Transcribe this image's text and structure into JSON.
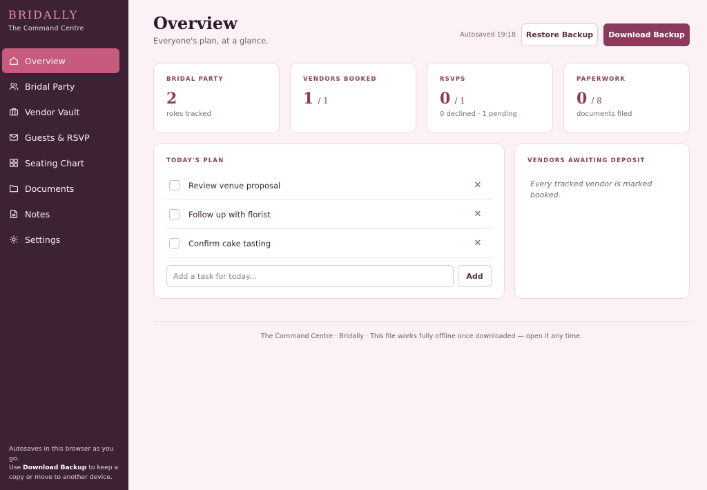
{
  "brand": {
    "name": "BRIDALLY",
    "subtitle": "The Command Centre"
  },
  "nav": [
    {
      "label": "Overview",
      "icon": "home-icon",
      "active": true
    },
    {
      "label": "Bridal Party",
      "icon": "users-icon",
      "active": false
    },
    {
      "label": "Vendor Vault",
      "icon": "briefcase-icon",
      "active": false
    },
    {
      "label": "Guests & RSVP",
      "icon": "envelope-icon",
      "active": false
    },
    {
      "label": "Seating Chart",
      "icon": "grid-icon",
      "active": false
    },
    {
      "label": "Documents",
      "icon": "folder-icon",
      "active": false
    },
    {
      "label": "Notes",
      "icon": "document-icon",
      "active": false
    },
    {
      "label": "Settings",
      "icon": "gear-icon",
      "active": false
    }
  ],
  "sidebar_footer": {
    "line1": "Autosaves in this browser as you go.",
    "line2_prefix": "Use ",
    "line2_bold": "Download Backup",
    "line2_suffix": " to keep a copy or move to another device."
  },
  "header": {
    "title": "Overview",
    "subtitle": "Everyone's plan, at a glance.",
    "autosave": "Autosaved 19:18",
    "restore_label": "Restore Backup",
    "download_label": "Download Backup"
  },
  "stats": [
    {
      "label": "BRIDAL PARTY",
      "value": "2",
      "of": "",
      "caption": "roles tracked"
    },
    {
      "label": "VENDORS BOOKED",
      "value": "1",
      "of": "/ 1",
      "caption": ""
    },
    {
      "label": "RSVPS",
      "value": "0",
      "of": "/ 1",
      "caption": "0 declined · 1 pending"
    },
    {
      "label": "PAPERWORK",
      "value": "0",
      "of": "/ 8",
      "caption": "documents filed"
    }
  ],
  "plan": {
    "heading": "TODAY'S PLAN",
    "tasks": [
      {
        "text": "Review venue proposal",
        "done": false
      },
      {
        "text": "Follow up with florist",
        "done": false
      },
      {
        "text": "Confirm cake tasting",
        "done": false
      }
    ],
    "input_placeholder": "Add a task for today...",
    "add_label": "Add"
  },
  "deposit": {
    "heading": "VENDORS AWAITING DEPOSIT",
    "empty_text": "Every tracked vendor is marked booked."
  },
  "footer": "The Command Centre · Bridally · This file works fully offline once downloaded — open it any time.",
  "colors": {
    "sidebar": "#3d2236",
    "accent": "#8a3a5c",
    "active_nav": "#c75b7e",
    "background": "#fcf2f5"
  }
}
